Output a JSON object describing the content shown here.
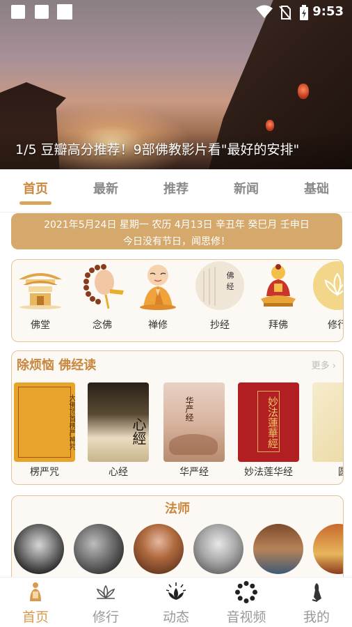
{
  "status_bar": {
    "time": "9:53"
  },
  "banner": {
    "caption": "1/5 豆瓣高分推荐！9部佛教影片看\"最好的安排\""
  },
  "tabs": [
    {
      "label": "首页",
      "active": true
    },
    {
      "label": "最新",
      "active": false
    },
    {
      "label": "推荐",
      "active": false
    },
    {
      "label": "新闻",
      "active": false
    },
    {
      "label": "基础",
      "active": false
    }
  ],
  "date_banner": {
    "line1": "2021年5月24日 星期一 农历 4月13日 辛丑年 癸巳月 壬申日",
    "line2": "今日没有节日，闻思修！"
  },
  "practice": {
    "items": [
      {
        "label": "佛堂",
        "icon": "temple-icon"
      },
      {
        "label": "念佛",
        "icon": "prayer-beads-icon"
      },
      {
        "label": "禅修",
        "icon": "meditating-monk-icon"
      },
      {
        "label": "抄经",
        "icon": "sutra-scroll-icon"
      },
      {
        "label": "拜佛",
        "icon": "buddha-statue-icon"
      },
      {
        "label": "修行",
        "icon": "lotus-icon"
      }
    ]
  },
  "sutras": {
    "title": "除烦恼 佛经读",
    "more": "更多",
    "books": [
      {
        "label": "楞严咒",
        "cover_text": "大佛顶首楞严神咒"
      },
      {
        "label": "心经",
        "cover_text": "心經"
      },
      {
        "label": "华严经",
        "cover_text": "华严经"
      },
      {
        "label": "妙法莲华经",
        "cover_text": "妙法蓮華經"
      },
      {
        "label": "圆"
      }
    ]
  },
  "masters": {
    "title": "法师"
  },
  "bottom_nav": [
    {
      "label": "首页",
      "icon": "home-buddha-icon",
      "active": true
    },
    {
      "label": "修行",
      "icon": "lotus-icon",
      "active": false
    },
    {
      "label": "动态",
      "icon": "lotus-rays-icon",
      "active": false
    },
    {
      "label": "音视频",
      "icon": "beads-ring-icon",
      "active": false
    },
    {
      "label": "我的",
      "icon": "praying-hand-icon",
      "active": false
    }
  ],
  "colors": {
    "accent": "#c9873e",
    "date_banner": "#d5a86b",
    "card_border": "#e3c39a",
    "inactive_text": "#999999"
  }
}
